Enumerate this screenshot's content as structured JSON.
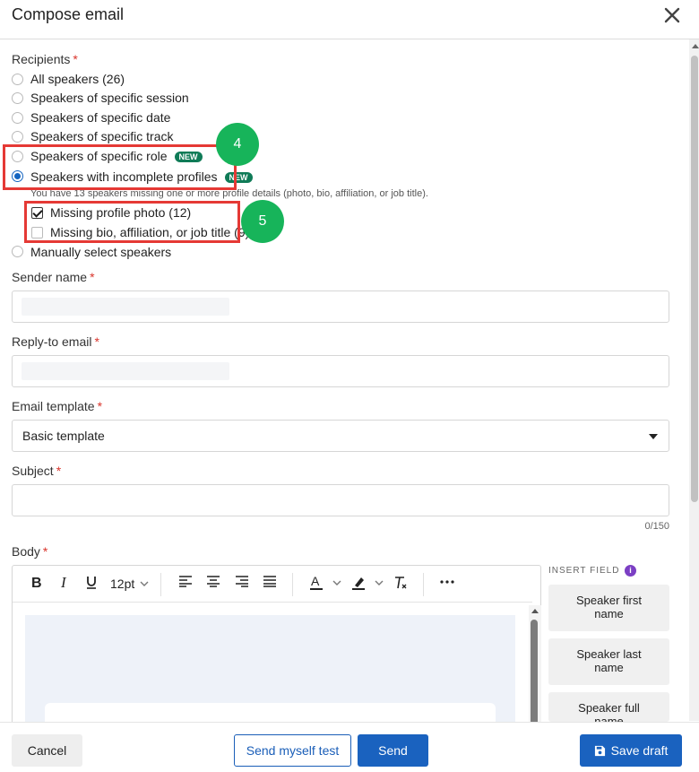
{
  "dialog": {
    "title": "Compose email"
  },
  "recipients": {
    "label": "Recipients",
    "required_mark": "*",
    "options": [
      {
        "label": "All speakers (26)",
        "selected": false
      },
      {
        "label": "Speakers of specific session",
        "selected": false
      },
      {
        "label": "Speakers of specific date",
        "selected": false
      },
      {
        "label": "Speakers of specific track",
        "selected": false
      },
      {
        "label": "Speakers of specific role",
        "badge": "NEW",
        "selected": false
      },
      {
        "label": "Speakers with incomplete profiles",
        "badge": "NEW",
        "selected": true
      },
      {
        "label": "Manually select speakers",
        "selected": false
      }
    ],
    "incomplete_note": "You have 13 speakers missing one or more profile details (photo, bio, affiliation, or job title).",
    "sub_options": [
      {
        "label": "Missing profile photo (12)",
        "checked": true
      },
      {
        "label": "Missing bio, affiliation, or job title (9)",
        "checked": false
      }
    ]
  },
  "annotations": {
    "marker_4": "4",
    "marker_5": "5",
    "highlight_color": "#e53935",
    "marker_color": "#17b45a"
  },
  "sender_name": {
    "label": "Sender name",
    "required_mark": "*"
  },
  "reply_to": {
    "label": "Reply-to email",
    "required_mark": "*"
  },
  "template": {
    "label": "Email template",
    "required_mark": "*",
    "value": "Basic template"
  },
  "subject": {
    "label": "Subject",
    "required_mark": "*",
    "value": "",
    "counter": "0/150"
  },
  "body": {
    "label": "Body",
    "required_mark": "*",
    "font_size": "12pt",
    "toolbar": [
      "bold-icon",
      "italic-icon",
      "underline-icon",
      "font-size",
      "align-left-icon",
      "align-center-icon",
      "align-right-icon",
      "align-justify-icon",
      "text-color-icon",
      "highlight-icon",
      "clear-format-icon",
      "more-icon"
    ]
  },
  "insert_field": {
    "title": "INSERT FIELD",
    "info": "i",
    "fields": [
      {
        "line1": "Speaker first",
        "line2": "name"
      },
      {
        "line1": "Speaker last",
        "line2": "name"
      },
      {
        "line1": "Speaker full",
        "line2": "name"
      }
    ]
  },
  "footer": {
    "cancel": "Cancel",
    "send_test": "Send myself test",
    "send": "Send",
    "save_draft": "Save draft"
  },
  "colors": {
    "primary": "#1a62bf",
    "badge": "#0f7b57",
    "required": "#d9342b"
  }
}
